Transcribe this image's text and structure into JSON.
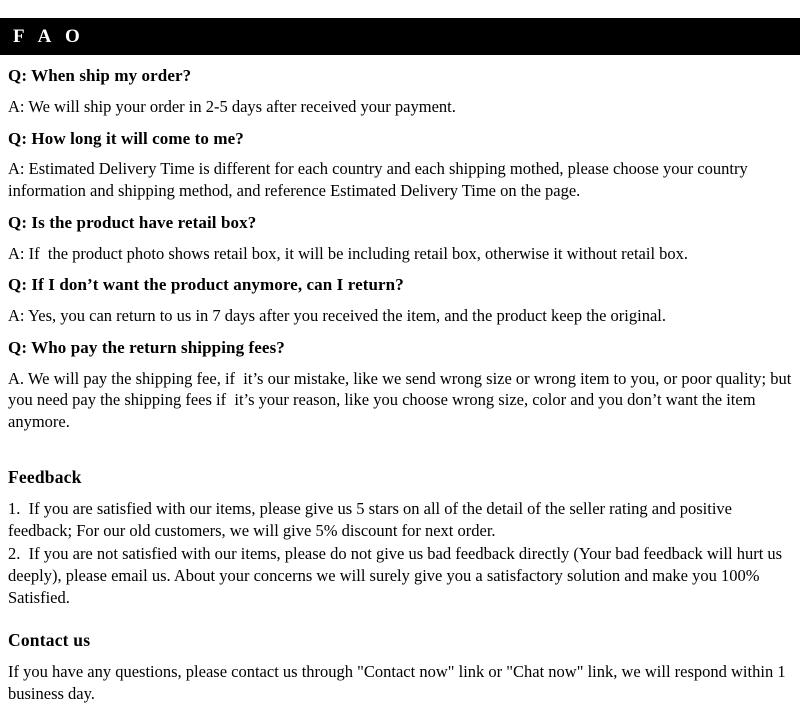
{
  "banner": {
    "title": "F A O"
  },
  "faq": {
    "items": [
      {
        "question": "Q: When ship my order?",
        "answer": "A: We will ship your order in 2-5 days after received your payment."
      },
      {
        "question": "Q: How long it will come to me?",
        "answer": "A: Estimated Delivery Time is different for each country and each shipping mothed, please choose your country information and shipping method, and reference Estimated Delivery Time on the page."
      },
      {
        "question": "Q: Is the product have retail box?",
        "answer": "A: If  the product photo shows retail box, it will be including retail box, otherwise it without retail box."
      },
      {
        "question": "Q: If I don’t want the product anymore, can I return?",
        "answer": "A: Yes, you can return to us in 7 days after you received the item, and the product keep the original."
      },
      {
        "question": "Q: Who pay the return shipping fees?",
        "answer": "A. We will pay the shipping fee, if  it’s our mistake, like we send wrong size or wrong item to you, or poor quality; but you need pay the shipping fees if  it’s your reason, like you choose wrong size, color and you don’t want the item anymore."
      }
    ]
  },
  "feedback": {
    "heading": "Feedback",
    "item1": "1.  If you are satisfied with our items, please give us 5 stars on all of the detail of the seller rating and positive feedback; For our old customers, we will give 5% discount for next order.",
    "item2": "2.  If you are not satisfied with our items, please do not give us bad feedback directly (Your bad feedback will hurt us deeply), please email us. About your concerns we will surely give you a satisfactory solution and make you 100% Satisfied."
  },
  "contact": {
    "heading": "Contact us",
    "text": "If you have any questions, please contact us through \"Contact now\" link or \"Chat now\" link, we will respond within 1 business day."
  },
  "colors": {
    "banner_background": "#000000",
    "banner_text": "#ffffff",
    "page_background": "#ffffff",
    "body_text": "#000000"
  }
}
